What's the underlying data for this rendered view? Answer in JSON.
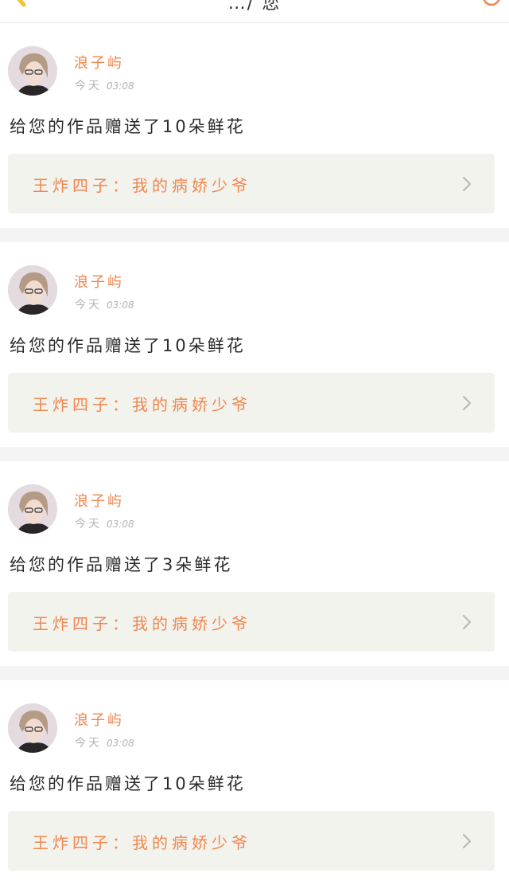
{
  "header": {
    "title": "…/ 您",
    "back_icon": "back-arrow-icon",
    "action_icon": "smile-icon"
  },
  "colors": {
    "accent": "#f0864e",
    "card_link_bg": "#f3f3ee",
    "divider": "#f4f4f4"
  },
  "notifications": [
    {
      "user": "浪子屿",
      "day": "今天",
      "time": "03:08",
      "message": "给您的作品赠送了10朵鲜花",
      "work": "王炸四子：我的病娇少爷"
    },
    {
      "user": "浪子屿",
      "day": "今天",
      "time": "03:08",
      "message": "给您的作品赠送了10朵鲜花",
      "work": "王炸四子：我的病娇少爷"
    },
    {
      "user": "浪子屿",
      "day": "今天",
      "time": "03:08",
      "message": "给您的作品赠送了3朵鲜花",
      "work": "王炸四子：我的病娇少爷"
    },
    {
      "user": "浪子屿",
      "day": "今天",
      "time": "03:08",
      "message": "给您的作品赠送了10朵鲜花",
      "work": "王炸四子：我的病娇少爷"
    }
  ]
}
